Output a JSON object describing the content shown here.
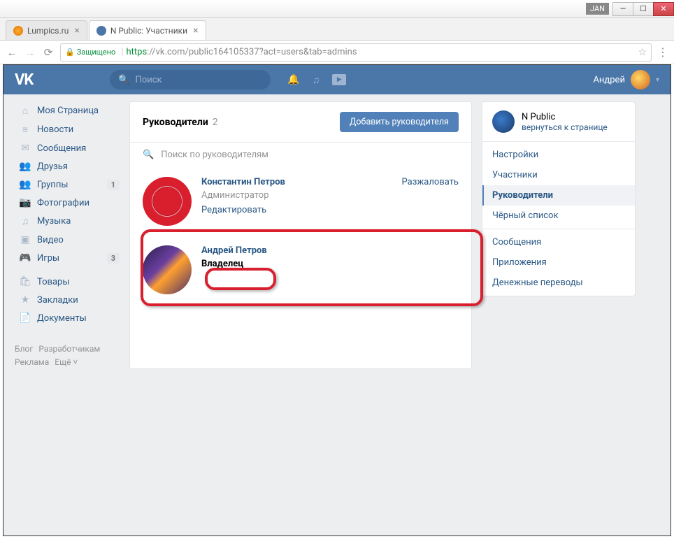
{
  "window": {
    "jan": "JAN"
  },
  "tabs": [
    {
      "title": "Lumpics.ru"
    },
    {
      "title": "N Public: Участники"
    }
  ],
  "address": {
    "secure": "Защищено",
    "https": "https",
    "url": "://vk.com/public164105337?act=users&tab=admins"
  },
  "vk": {
    "search_placeholder": "Поиск",
    "username": "Андрей"
  },
  "nav": {
    "items": [
      {
        "label": "Моя Страница",
        "icon": "⌂"
      },
      {
        "label": "Новости",
        "icon": "≡"
      },
      {
        "label": "Сообщения",
        "icon": "✉"
      },
      {
        "label": "Друзья",
        "icon": "👥"
      },
      {
        "label": "Группы",
        "icon": "👥",
        "badge": "1"
      },
      {
        "label": "Фотографии",
        "icon": "📷"
      },
      {
        "label": "Музыка",
        "icon": "♫"
      },
      {
        "label": "Видео",
        "icon": "▣"
      },
      {
        "label": "Игры",
        "icon": "🎮",
        "badge": "3"
      }
    ],
    "items2": [
      {
        "label": "Товары",
        "icon": "🛍"
      },
      {
        "label": "Закладки",
        "icon": "★"
      },
      {
        "label": "Документы",
        "icon": "📄"
      }
    ]
  },
  "footer": {
    "l1a": "Блог",
    "l1b": "Разработчикам",
    "l2a": "Реклама",
    "l2b": "Ещё ˅"
  },
  "main": {
    "title": "Руководители",
    "count": "2",
    "add_btn": "Добавить руководителя",
    "search_placeholder": "Поиск по руководителям",
    "members": [
      {
        "name": "Константин Петров",
        "role": "Администратор",
        "edit": "Редактировать",
        "action": "Разжаловать"
      },
      {
        "name": "Андрей Петров",
        "role": "Владелец"
      }
    ]
  },
  "right": {
    "title": "N Public",
    "sub": "вернуться к странице",
    "menu1": [
      {
        "label": "Настройки"
      },
      {
        "label": "Участники"
      },
      {
        "label": "Руководители",
        "active": true
      },
      {
        "label": "Чёрный список"
      }
    ],
    "menu2": [
      {
        "label": "Сообщения"
      },
      {
        "label": "Приложения"
      },
      {
        "label": "Денежные переводы"
      }
    ]
  }
}
